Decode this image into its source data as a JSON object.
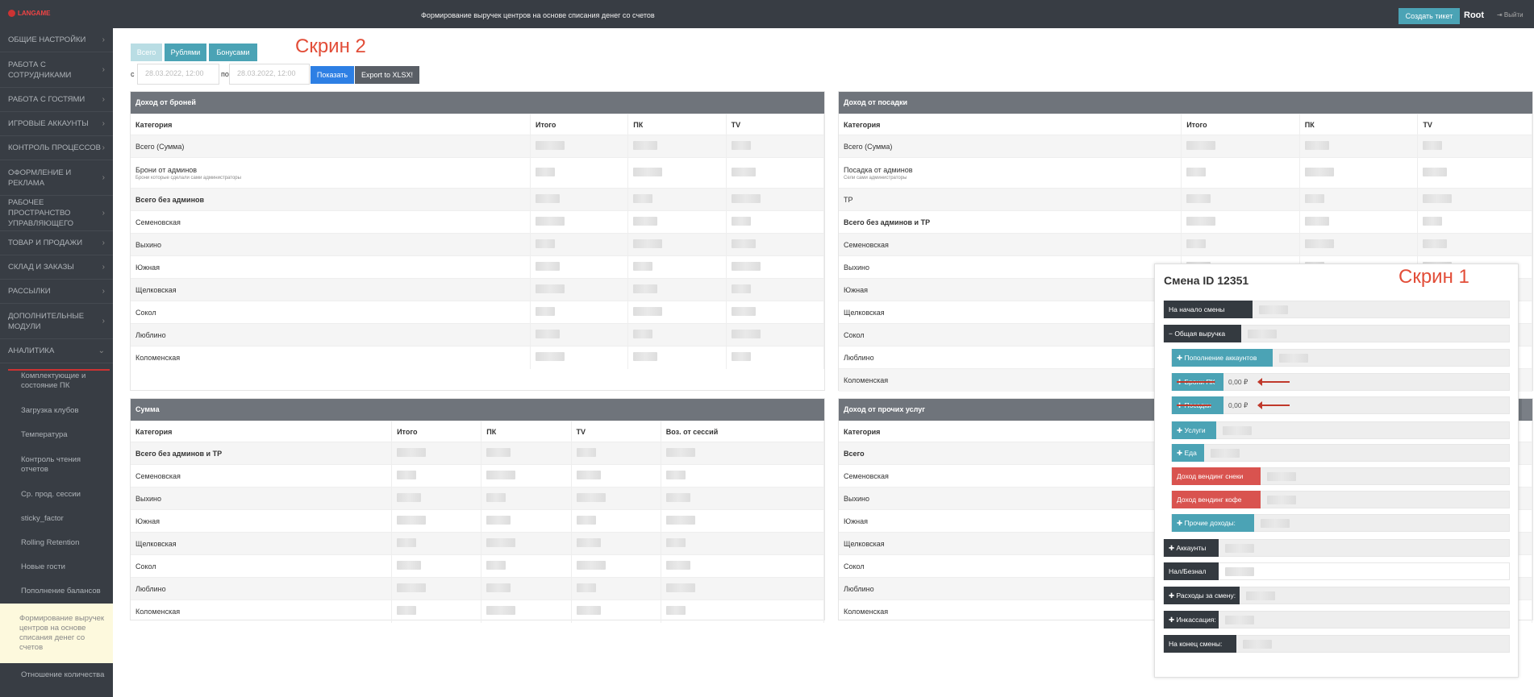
{
  "header": {
    "logo": "LANGAME",
    "title": "Формирование выручек центров на основе списания денег со счетов",
    "ticket": "Создать тикет",
    "user": "Root",
    "logout": "⇥ Выйти"
  },
  "sidebar": {
    "items": [
      "ОБЩИЕ НАСТРОЙКИ",
      "РАБОТА С СОТРУДНИКАМИ",
      "РАБОТА С ГОСТЯМИ",
      "ИГРОВЫЕ АККАУНТЫ",
      "КОНТРОЛЬ ПРОЦЕССОВ",
      "ОФОРМЛЕНИЕ И РЕКЛАМА",
      "РАБОЧЕЕ ПРОСТРАНСТВО УПРАВЛЯЮЩЕГО",
      "ТОВАР И ПРОДАЖИ",
      "СКЛАД И ЗАКАЗЫ",
      "РАССЫЛКИ",
      "ДОПОЛНИТЕЛЬНЫЕ МОДУЛИ",
      "АНАЛИТИКА"
    ],
    "sub": [
      "Комплектующие и состояние ПК",
      "Загрузка клубов",
      "Температура",
      "Контроль чтения отчетов",
      "Ср. прод. сессии",
      "sticky_factor",
      "Rolling Retention",
      "Новые гости",
      "Пополнение балансов",
      "Формирование выручек центров на основе списания денег со счетов",
      "Отношение количества"
    ]
  },
  "filters": {
    "tab_all": "Всего",
    "tab_rub": "Рублями",
    "tab_bonus": "Бонусами",
    "from_label": "с",
    "from_value": "28.03.2022, 12:00",
    "to_label": "по",
    "to_value": "28.03.2022, 12:00",
    "show": "Показать",
    "export": "Export to XLSX!",
    "annot2": "Скрин 2"
  },
  "bookings": {
    "title": "Доход от броней",
    "cols": [
      "Категория",
      "Итого",
      "ПК",
      "TV"
    ],
    "rows": [
      "Всего (Сумма)",
      "Брони от админов",
      "Всего без админов",
      "Семеновская",
      "Выхино",
      "Южная",
      "Щелковская",
      "Сокол",
      "Люблино",
      "Коломенская"
    ],
    "note": "Брони которые сделали сами администраторы"
  },
  "seating": {
    "title": "Доход от посадки",
    "cols": [
      "Категория",
      "Итого",
      "ПК",
      "TV"
    ],
    "rows": [
      "Всего (Сумма)",
      "Посадка от админов",
      "ТР",
      "Всего без админов и ТР",
      "Семеновская",
      "Выхино",
      "Южная",
      "Щелковская",
      "Сокол",
      "Люблино",
      "Коломенская"
    ],
    "note": "Сели сами администраторы"
  },
  "sums": {
    "title": "Сумма",
    "cols": [
      "Категория",
      "Итого",
      "ПК",
      "TV",
      "Воз. от сессий"
    ],
    "rows": [
      "Всего без админов и ТР",
      "Семеновская",
      "Выхино",
      "Южная",
      "Щелковская",
      "Сокол",
      "Люблино",
      "Коломенская"
    ]
  },
  "other": {
    "title": "Доход от прочих услуг",
    "cols": [
      "Категория"
    ],
    "rows": [
      "Всего",
      "Семеновская",
      "Выхино",
      "Южная",
      "Щелковская",
      "Сокол",
      "Люблино",
      "Коломенская"
    ]
  },
  "shift": {
    "title": "Смена ID 12351",
    "annot1": "Скрин 1",
    "start": "На начало смены",
    "revenue": "− Общая выручка",
    "topup": "✚ Пополнение аккаунтов",
    "booking": "✚ Брони ПК",
    "seat": "✚ Посадки",
    "money": "0,00 ₽",
    "services": "✚ Услуги",
    "food": "✚ Еда",
    "vend_snacks": "Доход вендинг снеки",
    "vend_coffee": "Доход вендинг кофе",
    "other_income": "✚ Прочие доходы:",
    "accounts": "✚ Аккаунты",
    "cash": "Нал/Безнал",
    "expenses": "✚ Расходы за смену:",
    "collection": "✚ Инкассация:",
    "end": "На конец смены:"
  },
  "colors": {
    "teal": "#4ba3b5",
    "dark": "#343a40",
    "red": "#d9534f",
    "annot": "#e24d38"
  }
}
